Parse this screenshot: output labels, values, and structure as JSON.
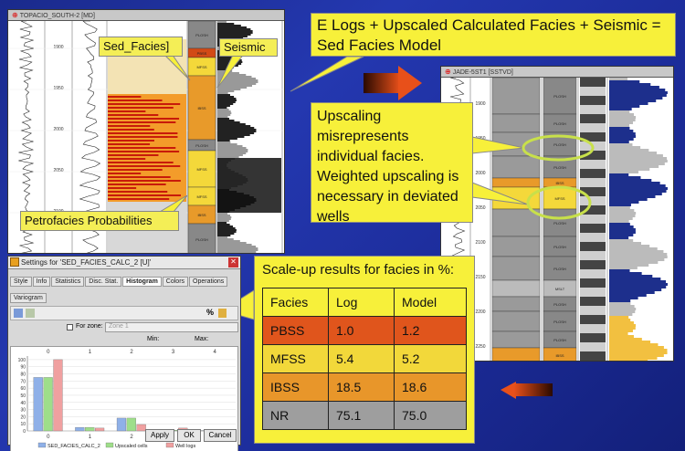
{
  "left_log": {
    "title": "TOPACIO_SOUTH-2 [MD]",
    "depth_ticks": [
      "1900",
      "1950",
      "2000",
      "2050",
      "2100"
    ],
    "facies_labels": [
      "PLOSH",
      "PBSS",
      "MFSS",
      "IBSS",
      "PLOSH",
      "MFSS",
      "MFSS",
      "IBSS",
      "PLOSH"
    ]
  },
  "right_log": {
    "title": "JADE-5ST1 [SSTVD]",
    "depth_ticks": [
      "1900",
      "1950",
      "2000",
      "2050",
      "2100",
      "2150",
      "2200",
      "2250"
    ],
    "facies_labels": [
      "PLOSH",
      "PLOSH",
      "PLOSH",
      "PLOSH",
      "IBSS",
      "MFSS",
      "PLOSH",
      "PLOSH",
      "PLOSH",
      "MSLT",
      "PLOSH",
      "PLOSH",
      "PLOSH",
      "IBSS"
    ]
  },
  "callouts": {
    "sed_facies": "Sed_Facies]",
    "seismic": "Seismic",
    "petrofacies": "Petrofacies Probabilities",
    "headline": "E Logs + Upscaled Calculated Facies + Seismic = Sed Facies Model",
    "upscaling": "Upscaling misrepresents individual facies. Weighted upscaling is necessary in deviated wells"
  },
  "results": {
    "title": "Scale-up results for facies in %:",
    "headers": [
      "Facies",
      "Log",
      "Model"
    ],
    "rows": [
      {
        "facies": "PBSS",
        "log": "1.0",
        "model": "1.2",
        "color": "#e0551c"
      },
      {
        "facies": "MFSS",
        "log": "5.4",
        "model": "5.2",
        "color": "#f2d83a"
      },
      {
        "facies": "IBSS",
        "log": "18.5",
        "model": "18.6",
        "color": "#e8962a"
      },
      {
        "facies": "NR",
        "log": "75.1",
        "model": "75.0",
        "color": "#9e9e9e"
      }
    ]
  },
  "dialog": {
    "title": "Settings for 'SED_FACIES_CALC_2 [U]'",
    "tabs": [
      "Style",
      "Info",
      "Statistics",
      "Disc. Stat.",
      "Histogram",
      "Colors",
      "Operations",
      "Variogram"
    ],
    "active_tab": "Histogram",
    "zone_checkbox": "For zone:",
    "zone_value": "Zone 1",
    "min_label": "Min:",
    "max_label": "Max:",
    "legend": [
      "SED_FACIES_CALC_2",
      "Upscaled cells",
      "Well logs"
    ],
    "buttons": {
      "apply": "Apply",
      "ok": "OK",
      "cancel": "Cancel"
    }
  },
  "chart_data": {
    "type": "bar",
    "categories": [
      "0",
      "1",
      "2",
      "3",
      "4"
    ],
    "series": [
      {
        "name": "SED_FACIES1_CALC_2",
        "values": [
          75,
          5,
          18,
          1,
          0.5
        ],
        "color": "#8fb0e8"
      },
      {
        "name": "Upscaled cells",
        "values": [
          75,
          5,
          18,
          1,
          0.5
        ],
        "color": "#9ede8a"
      },
      {
        "name": "Well logs",
        "values": [
          100,
          4,
          9,
          4,
          1
        ],
        "color": "#f0a0a0"
      }
    ],
    "ylim": [
      0,
      105
    ],
    "ticks_y": [
      "0",
      "10",
      "20",
      "30",
      "40",
      "50",
      "60",
      "70",
      "80",
      "90",
      "100"
    ]
  },
  "colors": {
    "callout": "#f7f03a",
    "arrow_dark": "#3a0c00",
    "arrow_light": "#e84a12"
  }
}
